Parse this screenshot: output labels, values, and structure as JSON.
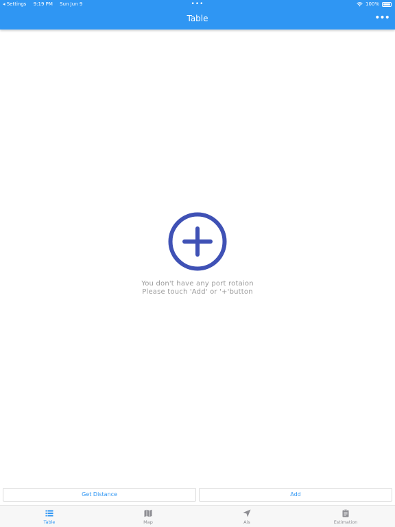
{
  "status_bar": {
    "back_app": "◂ Settings",
    "time": "9:19 PM",
    "date": "Sun Jun 9",
    "battery": "100%"
  },
  "nav": {
    "title": "Table",
    "more_icon": "ellipsis-icon"
  },
  "empty_state": {
    "icon": "add-circle-icon",
    "line1": "You don't have any port rotaion",
    "line2": "Please touch 'Add' or '+'button"
  },
  "actions": {
    "get_distance": "Get Distance",
    "add": "Add"
  },
  "tabs": [
    {
      "label": "Table",
      "icon": "list-icon",
      "active": true
    },
    {
      "label": "Map",
      "icon": "map-icon",
      "active": false
    },
    {
      "label": "Ais",
      "icon": "navigation-arrow-icon",
      "active": false
    },
    {
      "label": "Estimation",
      "icon": "clipboard-icon",
      "active": false
    }
  ],
  "colors": {
    "primary": "#2f96f3",
    "accent_icon": "#3f51b5",
    "muted_text": "#9b9b9b",
    "inactive_tab": "#8e8e93"
  }
}
